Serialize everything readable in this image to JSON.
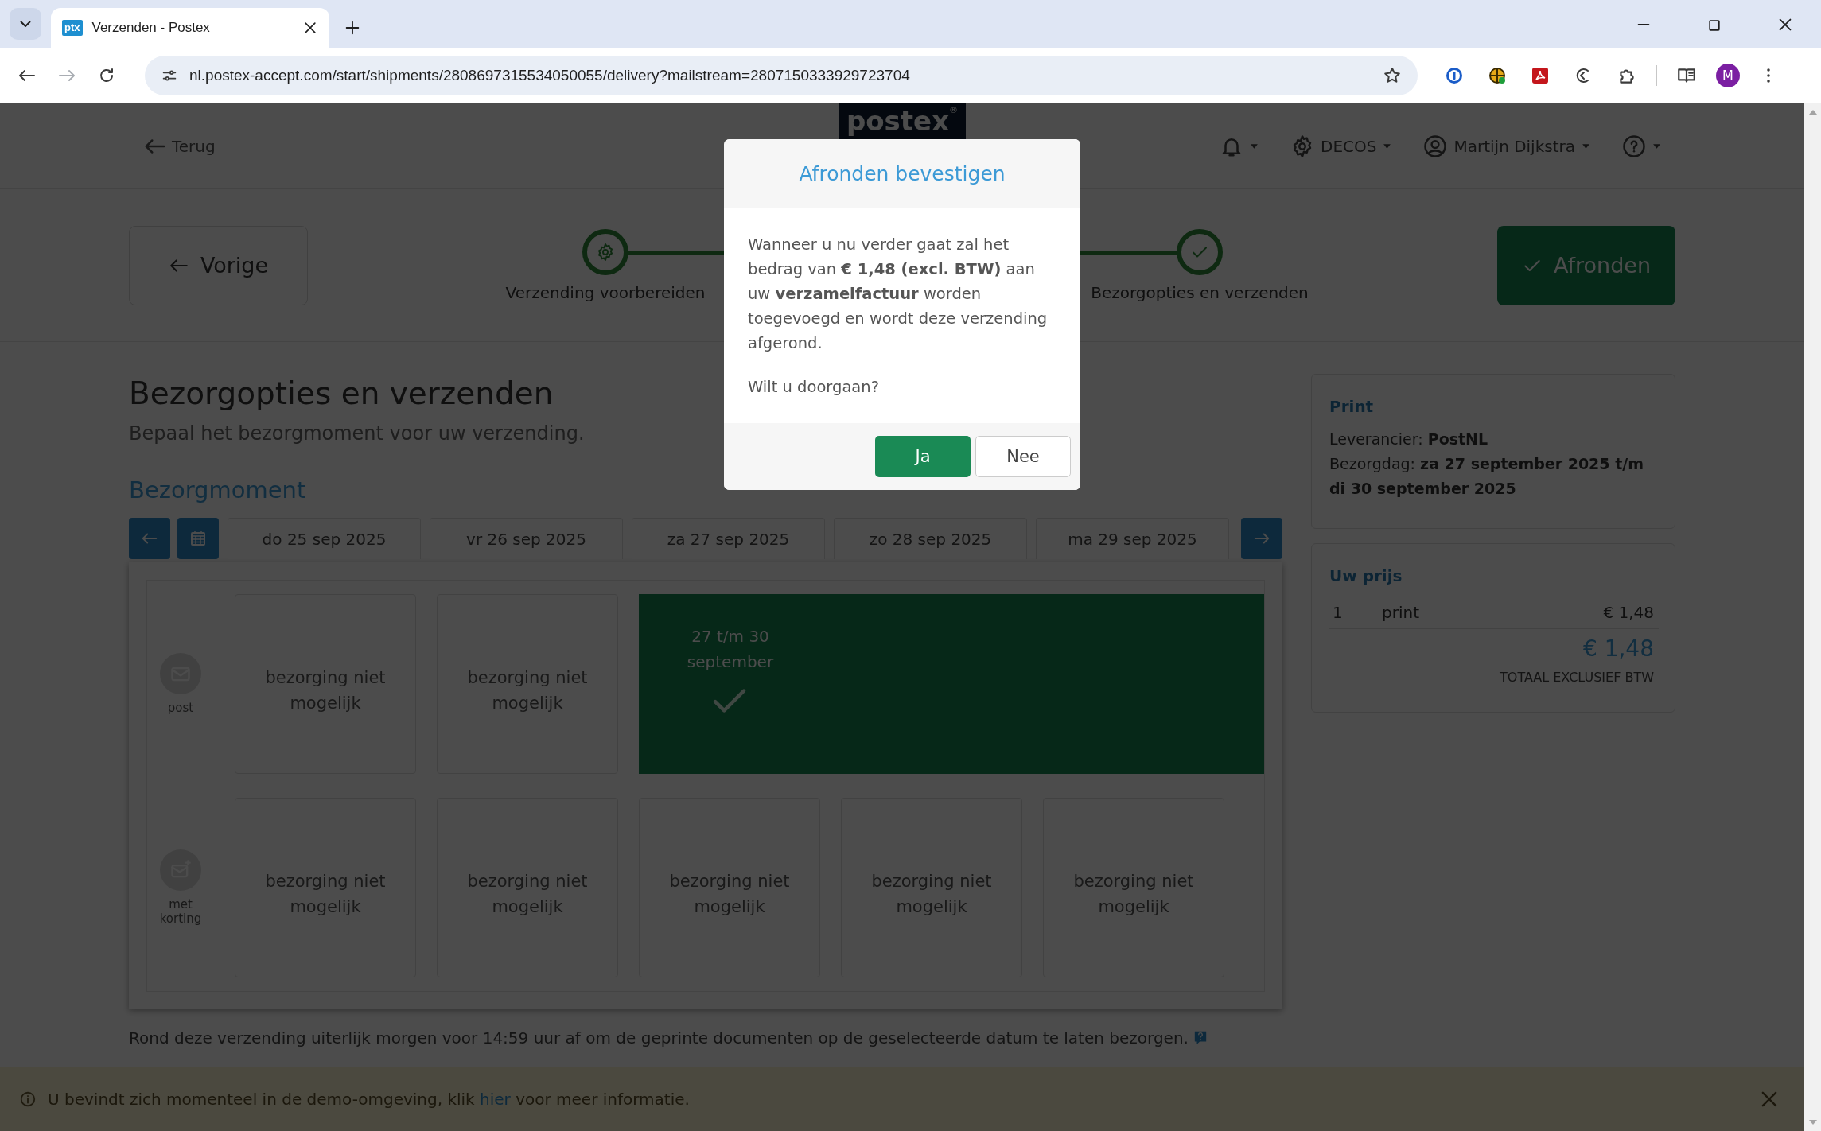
{
  "browser": {
    "tabs": [
      {
        "favicon": "ptx",
        "title": "Verzenden - Postex",
        "selected": true
      }
    ],
    "forward_disabled": true,
    "url": "nl.postex-accept.com/start/shipments/2808697315534050055/delivery?mailstream=2807150333929723704",
    "profile": "M"
  },
  "header": {
    "back": "Terug",
    "logo": "postex",
    "logo_mark": "®",
    "menus": [
      {
        "kind": "bell"
      },
      {
        "kind": "gear",
        "label": "DECOS"
      },
      {
        "kind": "user",
        "label": "Martijn Dijkstra"
      },
      {
        "kind": "help"
      }
    ]
  },
  "stepper": {
    "previous": "Vorige",
    "finish": "Afronden",
    "steps": [
      {
        "label": "Verzending voorbereiden",
        "kind": "gear"
      },
      {
        "label": "Bezorgopties en verzenden",
        "kind": "check"
      }
    ]
  },
  "content": {
    "title": "Bezorgopties en verzenden",
    "subtitle": "Bepaal het bezorgmoment voor uw verzending.",
    "section_title": "Bezorgmoment",
    "dates": [
      "do 25 sep 2025",
      "vr 26 sep 2025",
      "za 27 sep 2025",
      "zo 28 sep 2025",
      "ma 29 sep 2025"
    ],
    "rows": [
      {
        "label": "post",
        "kind": "post",
        "cells": [
          {
            "text": "bezorging niet mogelijk",
            "selected": false
          },
          {
            "text": "bezorging niet mogelijk",
            "selected": false
          },
          {
            "text": "27 t/m 30 september",
            "selected": true
          }
        ]
      },
      {
        "label": "met korting",
        "kind": "discount",
        "cells": [
          {
            "text": "bezorging niet mogelijk",
            "selected": false
          },
          {
            "text": "bezorging niet mogelijk",
            "selected": false
          },
          {
            "text": "bezorging niet mogelijk",
            "selected": false
          },
          {
            "text": "bezorging niet mogelijk",
            "selected": false
          },
          {
            "text": "bezorging niet mogelijk",
            "selected": false
          }
        ]
      }
    ],
    "note": "Rond deze verzending uiterlijk morgen voor 14:59 uur af om de geprinte documenten op de geselecteerde datum te laten bezorgen."
  },
  "sidebar": {
    "print": {
      "title": "Print",
      "lines": [
        "Leverancier: **PostNL**",
        "Bezorgdag: **za 27 september 2025 t/m di 30 september 2025**"
      ]
    },
    "price": {
      "title": "Uw prijs",
      "items": [
        {
          "qty": "1",
          "name": "print",
          "price": "€ 1,48"
        }
      ],
      "total": "€ 1,48",
      "total_label": "TOTAAL EXCLUSIEF BTW"
    }
  },
  "banner": {
    "text_before": "U bevindt zich momenteel in de demo-omgeving, klik ",
    "link": "hier",
    "text_after": " voor meer informatie."
  },
  "modal": {
    "title": "Afronden bevestigen",
    "paragraphs": [
      "Wanneer u nu verder gaat zal het bedrag van **€ 1,48 (excl. BTW)** aan uw **verzamelfactuur** worden toegevoegd en wordt deze verzending afgerond.",
      "Wilt u doorgaan?"
    ],
    "buttons": [
      {
        "label": "Ja",
        "kind": "primary"
      },
      {
        "label": "Nee",
        "kind": "secondary"
      }
    ]
  }
}
